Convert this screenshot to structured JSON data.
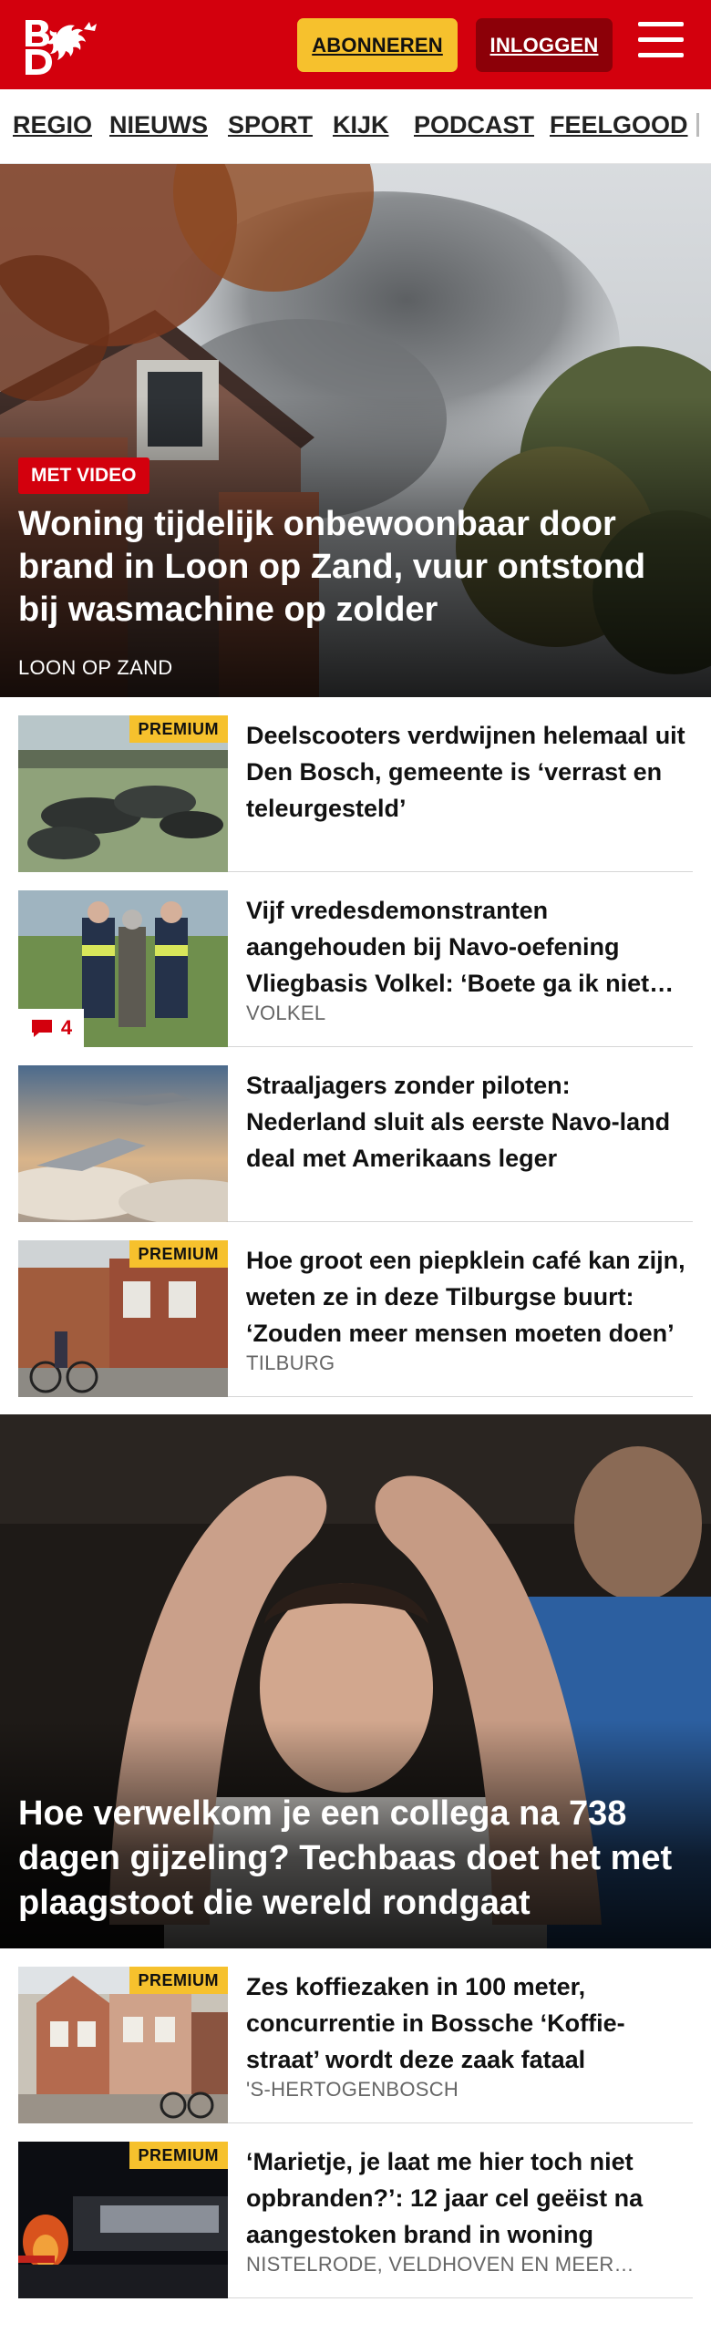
{
  "header": {
    "logo_alt": "BD",
    "subscribe_label": "ABONNEREN",
    "login_label": "INLOGGEN"
  },
  "nav": {
    "items": [
      "REGIO",
      "NIEUWS",
      "SPORT",
      "KIJK",
      "PODCAST",
      "FEELGOOD"
    ]
  },
  "hero1": {
    "badge": "MET VIDEO",
    "title": "Woning tijdelijk onbewoonbaar door brand in Loon op Zand, vuur ontstond bij wasmachine op zolder",
    "location": "LOON OP ZAND"
  },
  "articles": [
    {
      "premium": "PREMIUM",
      "title": "Deelscooters verdwijnen helemaal uit Den Bosch, gemeente is ‘verrast en teleurgesteld’",
      "location": ""
    },
    {
      "comments": "4",
      "title": "Vijf vredesdemonstranten aangehouden bij Navo-oefening Vliegbasis Volkel: ‘Boete ga ik niet betalen’",
      "location": "VOLKEL"
    },
    {
      "title": "Straaljagers zonder piloten: Nederland sluit als eerste Navo-land deal met Amerikaans leger",
      "location": ""
    },
    {
      "premium": "PREMIUM",
      "title": "Hoe groot een piepklein café kan zijn, weten ze in deze Tilburgse buurt: ‘Zouden meer mensen moeten doen’",
      "location": "TILBURG"
    }
  ],
  "hero2": {
    "title": "Hoe verwelkom je een collega na 738 dagen gijzeling? Techbaas doet het met plaagstoot die wereld rondgaat"
  },
  "articles2": [
    {
      "premium": "PREMIUM",
      "title": "Zes koffiezaken in 100 meter, concurrentie in Bossche ‘Koffie-straat’ wordt deze zaak fataal",
      "location": "'S-HERTOGENBOSCH"
    },
    {
      "premium": "PREMIUM",
      "title": "‘Marietje, je laat me hier toch niet opbranden?’: 12 jaar cel geëist na aangestoken brand in woning",
      "location": "NISTELRODE, VELDHOVEN EN MEER…"
    }
  ],
  "colors": {
    "brand_red": "#d3000d",
    "premium_yellow": "#f6c12d",
    "login_dark_red": "#8c0008"
  }
}
